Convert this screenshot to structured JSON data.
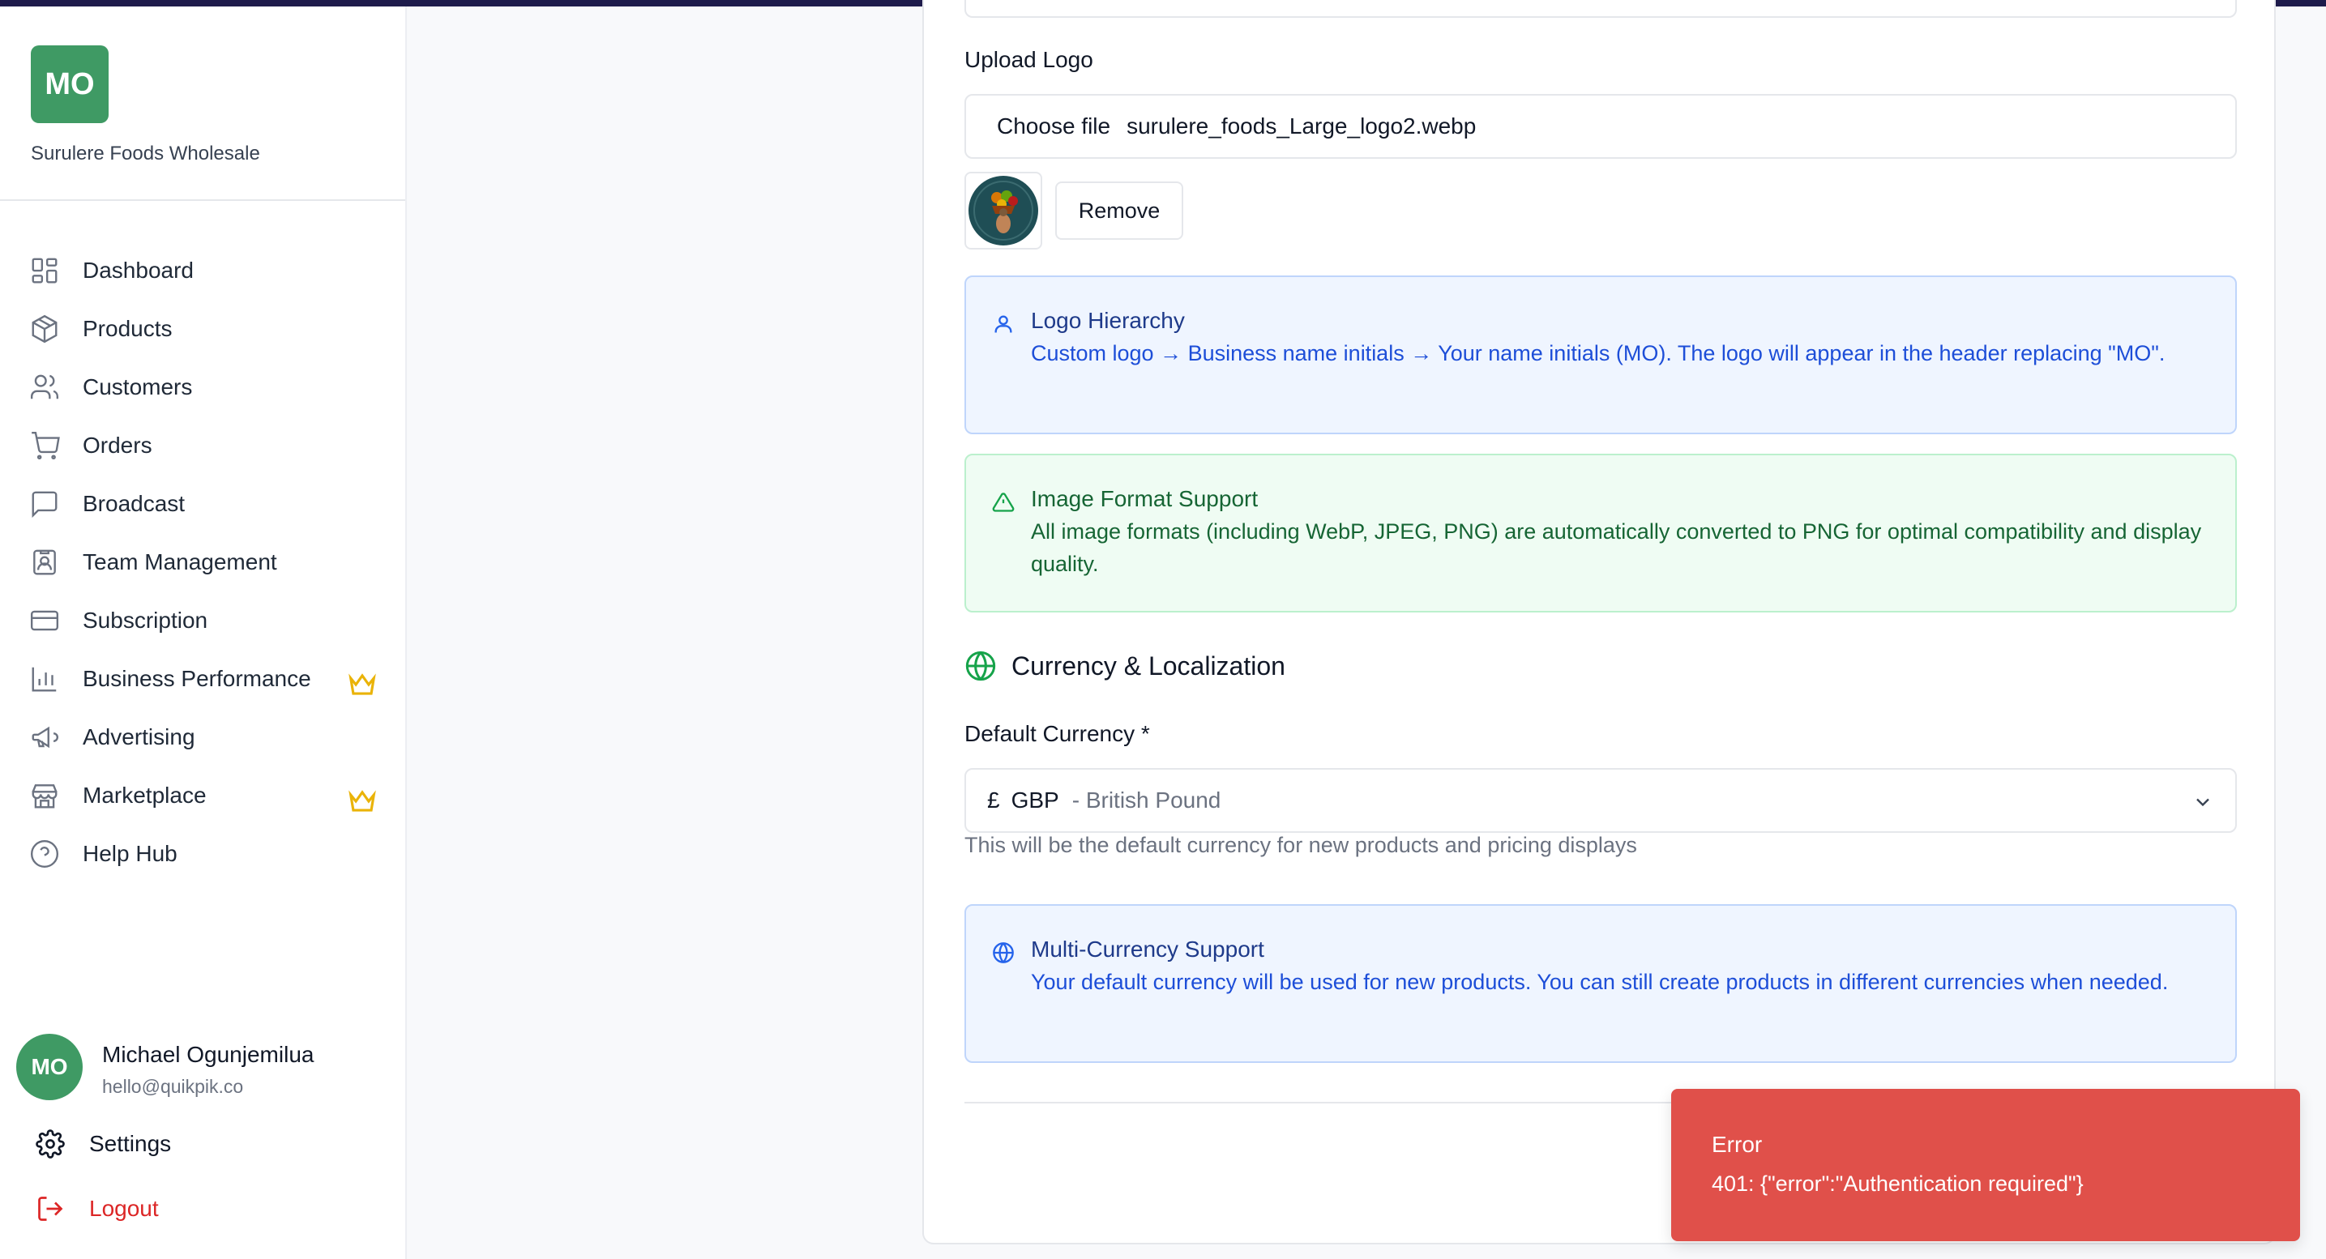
{
  "brand": {
    "initials": "MO",
    "name": "Surulere Foods Wholesale",
    "color": "#3f9a64"
  },
  "nav": {
    "items": [
      {
        "label": "Dashboard",
        "icon": "dashboard-icon"
      },
      {
        "label": "Products",
        "icon": "box-icon"
      },
      {
        "label": "Customers",
        "icon": "users-icon"
      },
      {
        "label": "Orders",
        "icon": "cart-icon"
      },
      {
        "label": "Broadcast",
        "icon": "message-icon"
      },
      {
        "label": "Team Management",
        "icon": "team-badge-icon"
      },
      {
        "label": "Subscription",
        "icon": "credit-card-icon"
      },
      {
        "label": "Business Performance",
        "icon": "bar-chart-icon",
        "premium": true
      },
      {
        "label": "Advertising",
        "icon": "megaphone-icon"
      },
      {
        "label": "Marketplace",
        "icon": "store-icon",
        "premium": true
      },
      {
        "label": "Help Hub",
        "icon": "help-circle-icon"
      }
    ]
  },
  "user": {
    "initials": "MO",
    "name": "Michael Ogunjemilua",
    "email": "hello@quikpik.co"
  },
  "sidebar_actions": {
    "settings": "Settings",
    "logout": "Logout"
  },
  "form": {
    "upload_logo_label": "Upload Logo",
    "choose_file_label": "Choose file",
    "file_name": "surulere_foods_Large_logo2.webp",
    "remove_label": "Remove"
  },
  "alerts": {
    "logo_hierarchy": {
      "title": "Logo Hierarchy",
      "text": "Custom logo → Business name initials → Your name initials (MO). The logo will appear in the header replacing \"MO\"."
    },
    "image_format": {
      "title": "Image Format Support",
      "text": "All image formats (including WebP, JPEG, PNG) are automatically converted to PNG for optimal compatibility and display quality."
    },
    "multi_currency": {
      "title": "Multi-Currency Support",
      "text": "Your default currency will be used for new products. You can still create products in different currencies when needed."
    }
  },
  "currency": {
    "section_title": "Currency & Localization",
    "field_label": "Default Currency *",
    "symbol": "£",
    "code": "GBP",
    "name": "- British Pound",
    "hint": "This will be the default currency for new products and pricing displays"
  },
  "toast": {
    "title": "Error",
    "message": "401: {\"error\":\"Authentication required\"}",
    "color": "#e0504a"
  }
}
